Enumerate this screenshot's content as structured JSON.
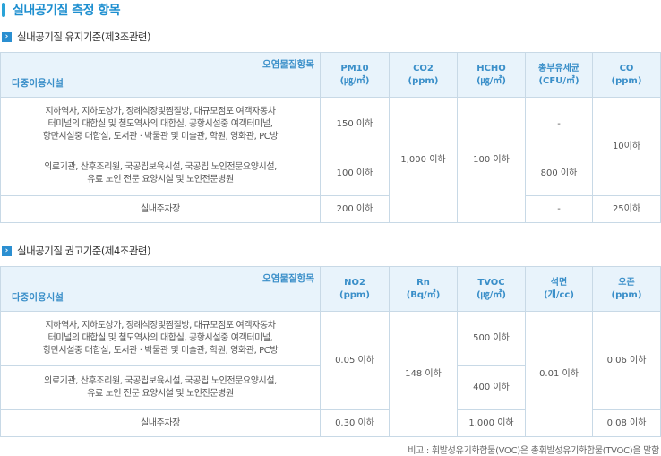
{
  "page_title": "실내공기질 측정 항목",
  "section1": {
    "heading": "실내공기질 유지기준(제3조관련)",
    "corner_top": "오염물질항목",
    "corner_bottom": "다중이용시설",
    "columns": [
      {
        "name": "PM10",
        "unit": "(㎍/㎥)"
      },
      {
        "name": "CO2",
        "unit": "(ppm)"
      },
      {
        "name": "HCHO",
        "unit": "(㎍/㎥)"
      },
      {
        "name": "총부유세균",
        "unit": "(CFU/㎥)"
      },
      {
        "name": "CO",
        "unit": "(ppm)"
      }
    ],
    "rows": [
      {
        "facility": [
          "지하역사, 지하도상가, 장례식장및찜질방, 대규모점포 여객자동차",
          "터미널의 대합실 및 철도역사의 대합실, 공항시설중 여객터미널,",
          "항만시설중 대합실, 도서관 · 박물관 및 미술관, 학원, 영화관, PC방"
        ],
        "pm10": "150 이하",
        "bacteria": "-"
      },
      {
        "facility": [
          "의료기관, 산후조리원, 국공립보육시설, 국공립 노인전문요양시설,",
          "유료 노인 전문 요양시설 및 노인전문병원"
        ],
        "pm10": "100 이하",
        "bacteria": "800 이하"
      },
      {
        "facility": [
          "실내주차장"
        ],
        "pm10": "200 이하",
        "bacteria": "-",
        "co": "25이하"
      }
    ],
    "co2_merged": "1,000 이하",
    "hcho_merged": "100 이하",
    "co_merged": "10이하"
  },
  "section2": {
    "heading": "실내공기질 권고기준(제4조관련)",
    "corner_top": "오염물질항목",
    "corner_bottom": "다중이용시설",
    "columns": [
      {
        "name": "NO2",
        "unit": "(ppm)"
      },
      {
        "name": "Rn",
        "unit": "(Bq/㎥)"
      },
      {
        "name": "TVOC",
        "unit": "(㎍/㎥)"
      },
      {
        "name": "석면",
        "unit": "(개/cc)"
      },
      {
        "name": "오존",
        "unit": "(ppm)"
      }
    ],
    "rows": [
      {
        "facility": [
          "지하역사, 지하도상가, 장례식장및찜질방, 대규모점포 여객자동차",
          "터미널의 대합실 및 철도역사의 대합실, 공항시설중 여객터미널,",
          "항만시설중 대합실, 도서관 · 박물관 및 미술관, 학원, 영화관, PC방"
        ],
        "tvoc": "500 이하"
      },
      {
        "facility": [
          "의료기관, 산후조리원, 국공립보육시설, 국공립 노인전문요양시설,",
          "유료 노인 전문 요양시설 및 노인전문병원"
        ],
        "tvoc": "400 이하"
      },
      {
        "facility": [
          "실내주차장"
        ],
        "no2": "0.30 이하",
        "tvoc": "1,000 이하",
        "ozone": "0.08 이하"
      }
    ],
    "no2_merged": "0.05 이하",
    "rn_merged": "148 이하",
    "asbestos_merged": "0.01 이하",
    "ozone_merged": "0.06 이하"
  },
  "note": "비고 : 휘발성유기화합물(VOC)은 총휘발성유기화합물(TVOC)을 말함",
  "colors": {
    "accent": "#1e8fd0",
    "header_bg": "#e8f3fb",
    "border": "#c8d9e6"
  }
}
